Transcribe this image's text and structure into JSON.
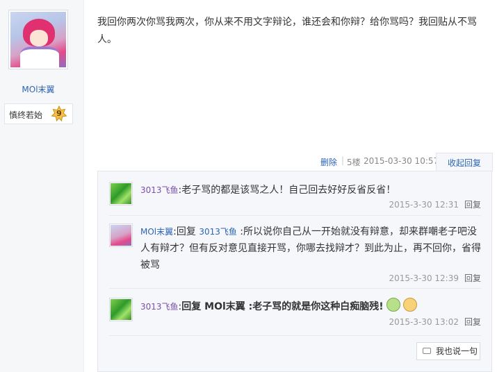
{
  "sidebar": {
    "username": "MOl末翼",
    "level_name": "慎终若始",
    "level_number": "9"
  },
  "post": {
    "content": "我回你两次你骂我两次，你从来不用文字辩论，谁还会和你辩？给你骂吗？我回贴从不骂人。",
    "tail": {
      "delete": "删除",
      "separator": "|",
      "floor": "5楼",
      "time": "2015-03-30 10:57",
      "collapse": "收起回复"
    }
  },
  "replies": [
    {
      "user": "3013飞鱼",
      "colon": ":",
      "text": "老子骂的都是该骂之人！自己回去好好反省反省！",
      "time": "2015-3-30 12:31",
      "reply_label": "回复"
    },
    {
      "user": "MOl末翼",
      "prefix": ":回复 ",
      "target": "3013飞鱼",
      "text": " :所以说你自己从一开始就没有辩意，却来群嘲老子吧没人有辩才？但有反对意见直接开骂，你哪去找辩才？到此为止，再不回你，省得被骂",
      "time": "2015-3-30 12:39",
      "reply_label": "回复"
    },
    {
      "user": "3013飞鱼",
      "prefix": ":",
      "text": "回复 MOl末翼 :老子骂的就是你这种白痴脑残!",
      "emojis": [
        "sick-face-emoji",
        "puffed-face-emoji"
      ],
      "time": "2015-3-30 13:02",
      "reply_label": "回复"
    }
  ],
  "say_button": "我也说一句",
  "colors": {
    "link": "#2d64b3",
    "reply_bg": "#f5f7fa",
    "sidebar_bg": "#f6f7f9"
  }
}
